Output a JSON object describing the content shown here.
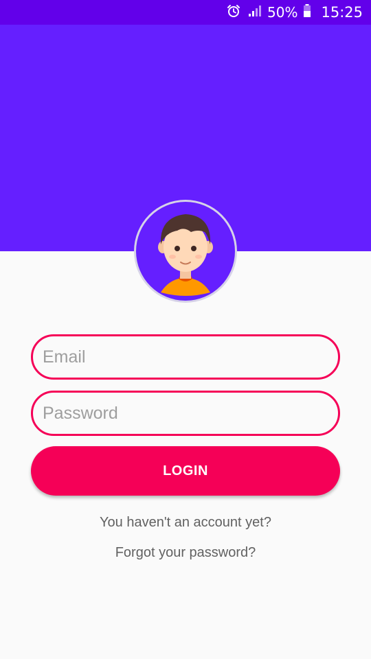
{
  "status_bar": {
    "battery": "50%",
    "time": "15:25",
    "icons": [
      "alarm-icon",
      "signal-icon",
      "battery-icon"
    ]
  },
  "colors": {
    "status_bar": "#6200EA",
    "header": "#651FFF",
    "accent": "#F50057",
    "background": "#FAFAFA"
  },
  "avatar": {
    "icon": "user-avatar-icon"
  },
  "form": {
    "email_placeholder": "Email",
    "email_value": "",
    "password_placeholder": "Password",
    "password_value": "",
    "login_label": "LOGIN"
  },
  "links": {
    "no_account": "You haven't an account yet?",
    "forgot_password": "Forgot your password?"
  }
}
